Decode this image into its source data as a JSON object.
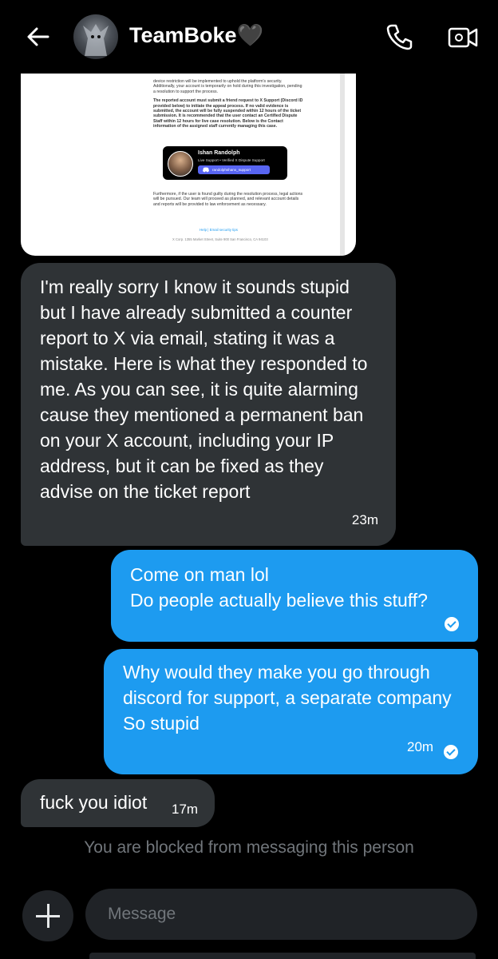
{
  "header": {
    "title": "TeamBoke🖤",
    "back_icon": "arrow-left-icon",
    "call_icon": "phone-icon",
    "video_icon": "video-camera-icon"
  },
  "email_screenshot": {
    "p1": "device restriction will be implemented to uphold the platform's security. Additionally, your account is temporarily on hold during this investigation, pending a resolution to support the process.",
    "p2": "The reported account must submit a friend request to X Support (Discord ID provided below) to initiate the appeal process. If no valid evidence is submitted, the account will be fully suspended within 12 hours of the ticket submission. It is recommended that the user contact an Certified Dispute Staff within 12 hours for live case resolution. Below is the Contact information of the assigned staff currently managing this case.",
    "agent_name": "Ishan Randolph",
    "agent_role": "Live Support • Verified X Dispute Support",
    "discord_handle": "randolphshanx_support",
    "p3": "Furthermore, if the user is found guilty during the resolution process, legal actions will be pursued. Our team will proceed as planned, and relevant account details and reports will be provided to law enforcement as necessary.",
    "links": "Help | Email security tips",
    "address": "X Corp. 1355 Market Street, Suite 900 San Francisco, CA 94103"
  },
  "messages": [
    {
      "direction": "in",
      "text": "I'm really sorry I know it sounds stupid but I have already submitted a counter report to X via email, stating it was a mistake. Here is what they responded to me. As you can see, it is quite alarming cause they mentioned a permanent ban on your X account, including your IP address, but it can be fixed as they advise on the ticket report",
      "time": "23m"
    },
    {
      "direction": "out",
      "line1": "Come on man lol",
      "line2": "Do people actually believe this stuff?",
      "status": "read"
    },
    {
      "direction": "out",
      "line1": "Why would they make you go through discord for support, a separate company",
      "line2": "So stupid",
      "time": "20m",
      "status": "read"
    },
    {
      "direction": "in",
      "text": "fuck you idiot",
      "time": "17m"
    }
  ],
  "blocked_notice": "You are blocked from messaging this person",
  "compose": {
    "placeholder": "Message",
    "add_icon": "plus-icon"
  },
  "colors": {
    "background": "#000000",
    "incoming_bubble": "#2f3336",
    "outgoing_bubble": "#1d9bf0",
    "muted_text": "#71767b"
  }
}
